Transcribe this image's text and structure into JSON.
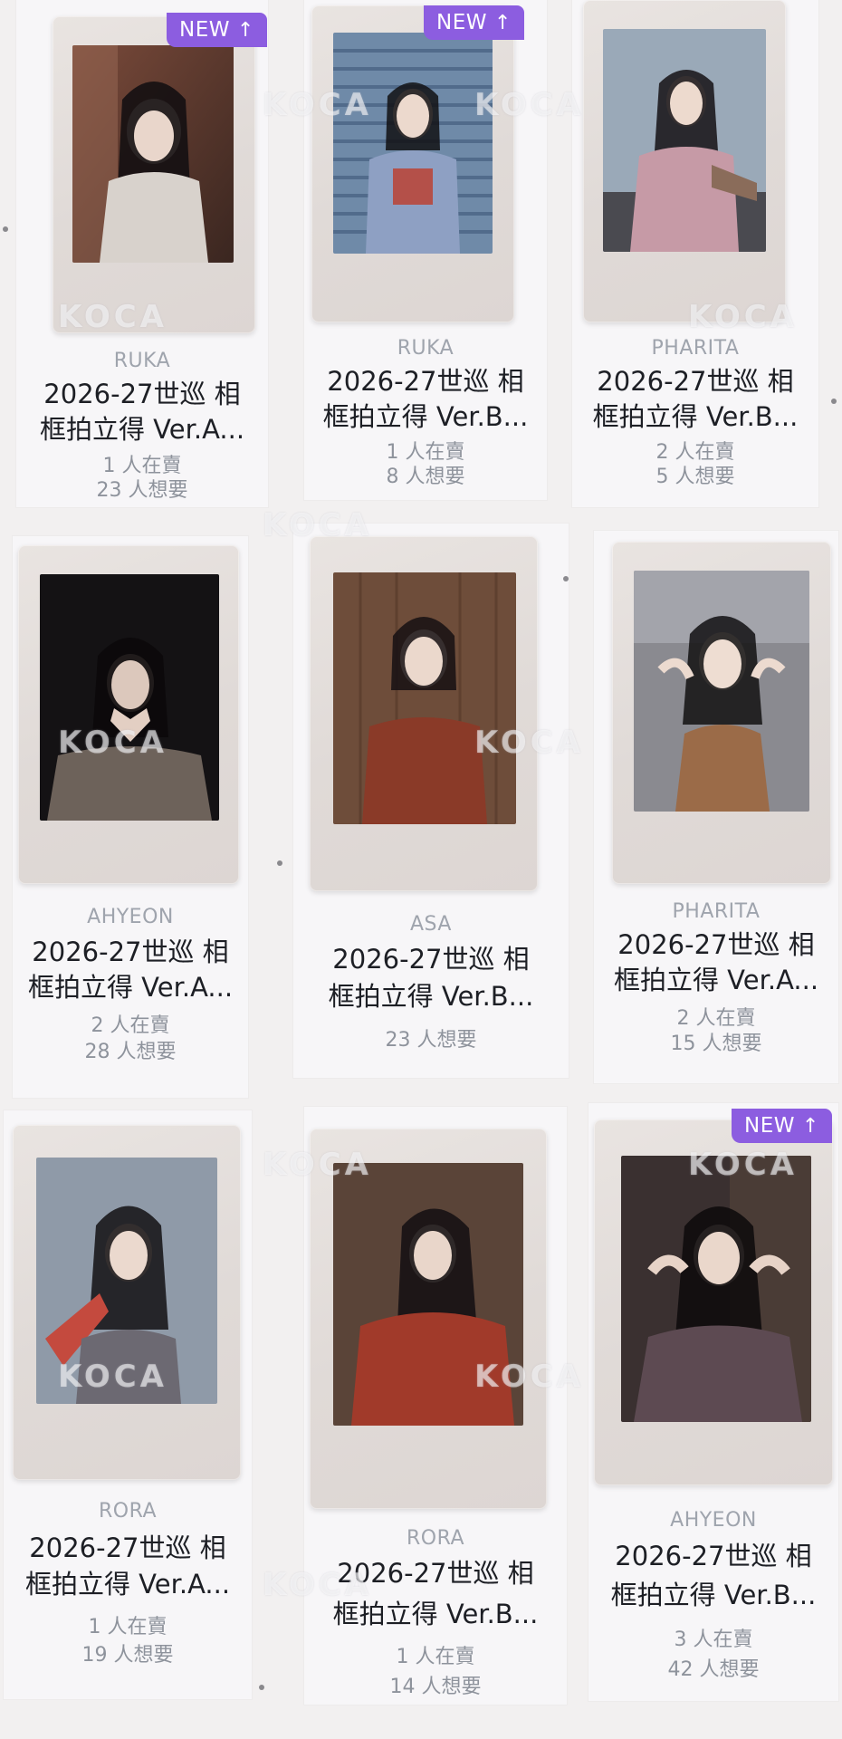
{
  "badge": {
    "label": "NEW",
    "arrow": "↑"
  },
  "watermark": "KOCA",
  "cards": [
    {
      "member": "RUKA",
      "title_line1": "2026-27世巡 相",
      "title_line2": "框拍立得 Ver.A...",
      "stat1": "1 人在賣",
      "stat2": "23 人想要",
      "is_new": true
    },
    {
      "member": "RUKA",
      "title_line1": "2026-27世巡 相",
      "title_line2": "框拍立得 Ver.B...",
      "stat1": "1 人在賣",
      "stat2": "8 人想要",
      "is_new": true
    },
    {
      "member": "PHARITA",
      "title_line1": "2026-27世巡 相",
      "title_line2": "框拍立得 Ver.B...",
      "stat1": "2 人在賣",
      "stat2": "5 人想要",
      "is_new": false
    },
    {
      "member": "AHYEON",
      "title_line1": "2026-27世巡 相",
      "title_line2": "框拍立得 Ver.A...",
      "stat1": "2 人在賣",
      "stat2": "28 人想要",
      "is_new": false
    },
    {
      "member": "ASA",
      "title_line1": "2026-27世巡 相",
      "title_line2": "框拍立得 Ver.B...",
      "stat1": "23 人想要",
      "stat2": "",
      "is_new": false
    },
    {
      "member": "PHARITA",
      "title_line1": "2026-27世巡 相",
      "title_line2": "框拍立得 Ver.A...",
      "stat1": "2 人在賣",
      "stat2": "15 人想要",
      "is_new": false
    },
    {
      "member": "RORA",
      "title_line1": "2026-27世巡 相",
      "title_line2": "框拍立得 Ver.A...",
      "stat1": "1 人在賣",
      "stat2": "19 人想要",
      "is_new": false
    },
    {
      "member": "RORA",
      "title_line1": "2026-27世巡 相",
      "title_line2": "框拍立得 Ver.B...",
      "stat1": "1 人在賣",
      "stat2": "14 人想要",
      "is_new": false
    },
    {
      "member": "AHYEON",
      "title_line1": "2026-27世巡 相",
      "title_line2": "框拍立得 Ver.B...",
      "stat1": "3 人在賣",
      "stat2": "42 人想要",
      "is_new": true
    }
  ],
  "colors": {
    "badge": "#8c5de0",
    "member": "#9fa4ad",
    "title": "#1d1f25",
    "stat": "#8e939c"
  },
  "icons": {
    "back": "chevron-left-icon"
  }
}
